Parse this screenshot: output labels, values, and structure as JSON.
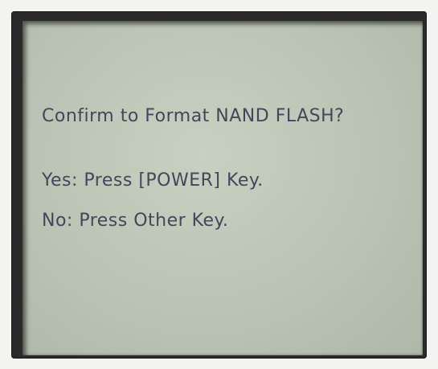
{
  "screen": {
    "prompt": "Confirm to Format NAND FLASH?",
    "yes_option": "Yes: Press [POWER] Key.",
    "no_option": "No: Press Other Key."
  },
  "colors": {
    "lcd_background": "#bfc8b8",
    "lcd_text": "#40485a",
    "bezel": "#2a2a2a",
    "device_body": "#f3f3f1"
  }
}
